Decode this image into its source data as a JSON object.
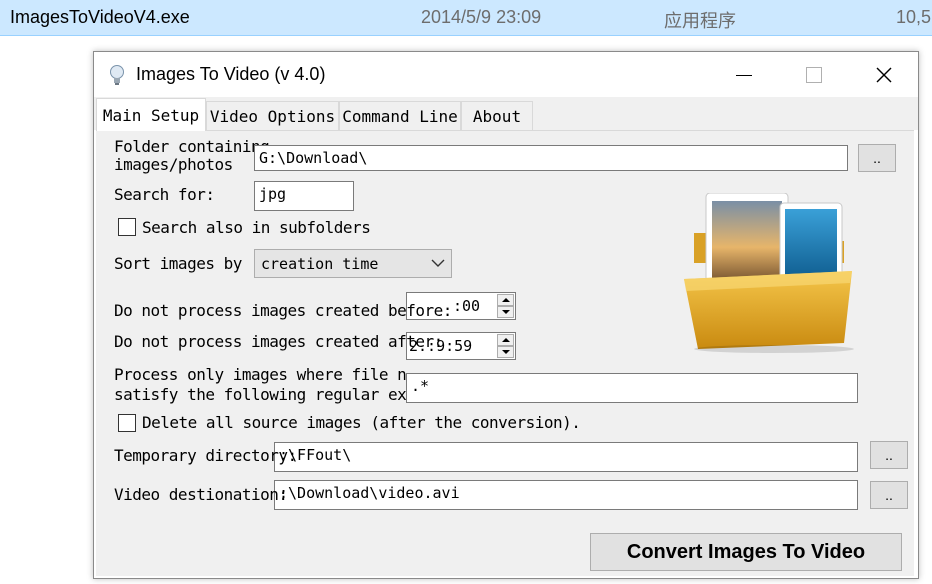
{
  "explorer_row": {
    "file_name": "ImagesToVideoV4.exe",
    "modified": "2014/5/9 23:09",
    "type": "应用程序",
    "size": "10,5"
  },
  "window": {
    "title": "Images To Video (v 4.0)"
  },
  "tabs": [
    {
      "label": "Main Setup",
      "active": true
    },
    {
      "label": "Video Options",
      "active": false
    },
    {
      "label": "Command Line",
      "active": false
    },
    {
      "label": "About",
      "active": false
    }
  ],
  "main_setup": {
    "folder_label_line1": "Folder containing",
    "folder_label_line2": "images/photos",
    "folder_value": "G:\\Download\\",
    "search_for_label": "Search for:",
    "search_for_value": "jpg",
    "subfolders_label": "Search also in subfolders",
    "subfolders_checked": false,
    "sort_label": "Sort images by",
    "sort_value": "creation time",
    "before_label": "Do not process images created before:",
    "before_value": ":00",
    "after_label": "Do not process images created after:",
    "after_value": "2.:9:59",
    "regex_label_line1": "Process only images where file n",
    "regex_label_line2": "satisfy the following regular ex",
    "regex_value": ".*",
    "delete_label": "Delete all source images (after the conversion).",
    "delete_checked": false,
    "temp_dir_label": "Temporary directory:",
    "temp_dir_value": ":\\FFout\\",
    "video_dest_label": "Video destionation:",
    "video_dest_value": ":\\Download\\video.avi",
    "browse_label": "..",
    "convert_label": "Convert Images To Video"
  },
  "colors": {
    "selection_row": "#cce8ff",
    "panel": "#f0f0f0",
    "button": "#e1e1e1"
  }
}
